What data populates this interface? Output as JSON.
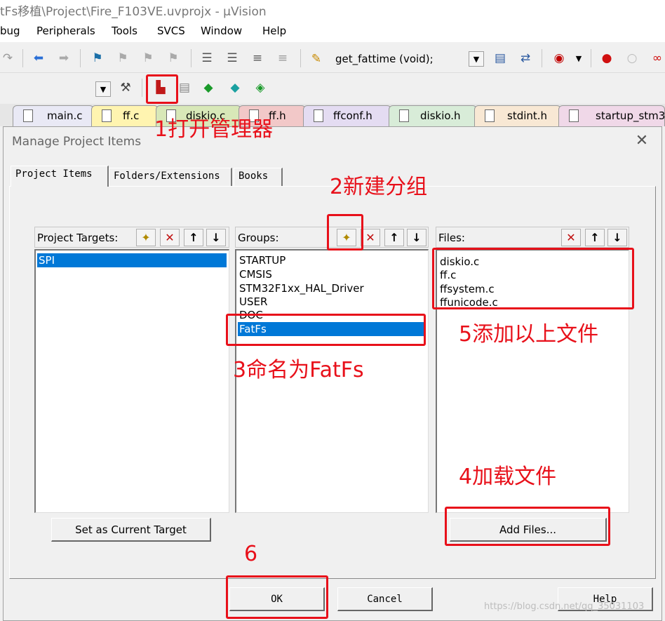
{
  "window": {
    "title": "tFs移植\\Project\\Fire_F103VE.uvprojx - µVision"
  },
  "menu": [
    "bug",
    "Peripherals",
    "Tools",
    "SVCS",
    "Window",
    "Help"
  ],
  "toolbar": {
    "function_combo": "get_fattime (void);"
  },
  "file_tabs": [
    "main.c",
    "ff.c",
    "diskio.c",
    "ff.h",
    "ffconf.h",
    "diskio.h",
    "stdint.h",
    "startup_stm3"
  ],
  "dialog": {
    "title": "Manage Project Items",
    "close": "✕",
    "tabs": [
      "Project Items",
      "Folders/Extensions",
      "Books"
    ],
    "targets": {
      "header": "Project Targets:",
      "items": [
        "SPI"
      ],
      "selected": 0
    },
    "groups": {
      "header": "Groups:",
      "items": [
        "STARTUP",
        "CMSIS",
        "STM32F1xx_HAL_Driver",
        "USER",
        "DOC",
        "FatFs"
      ],
      "selected": 5
    },
    "files": {
      "header": "Files:",
      "items": [
        "diskio.c",
        "ff.c",
        "ffsystem.c",
        "ffunicode.c"
      ]
    },
    "buttons": {
      "set_target": "Set as Current Target",
      "add_files": "Add Files...",
      "ok": "OK",
      "cancel": "Cancel",
      "help": "Help"
    }
  },
  "annotations": {
    "a1": "1打开管理器",
    "a2": "2新建分组",
    "a3": "3命名为FatFs",
    "a4": "4加载文件",
    "a5": "5添加以上文件",
    "a6": "6",
    "color": "#e8101a"
  },
  "watermark": "https://blog.csdn.net/qq_35031103"
}
